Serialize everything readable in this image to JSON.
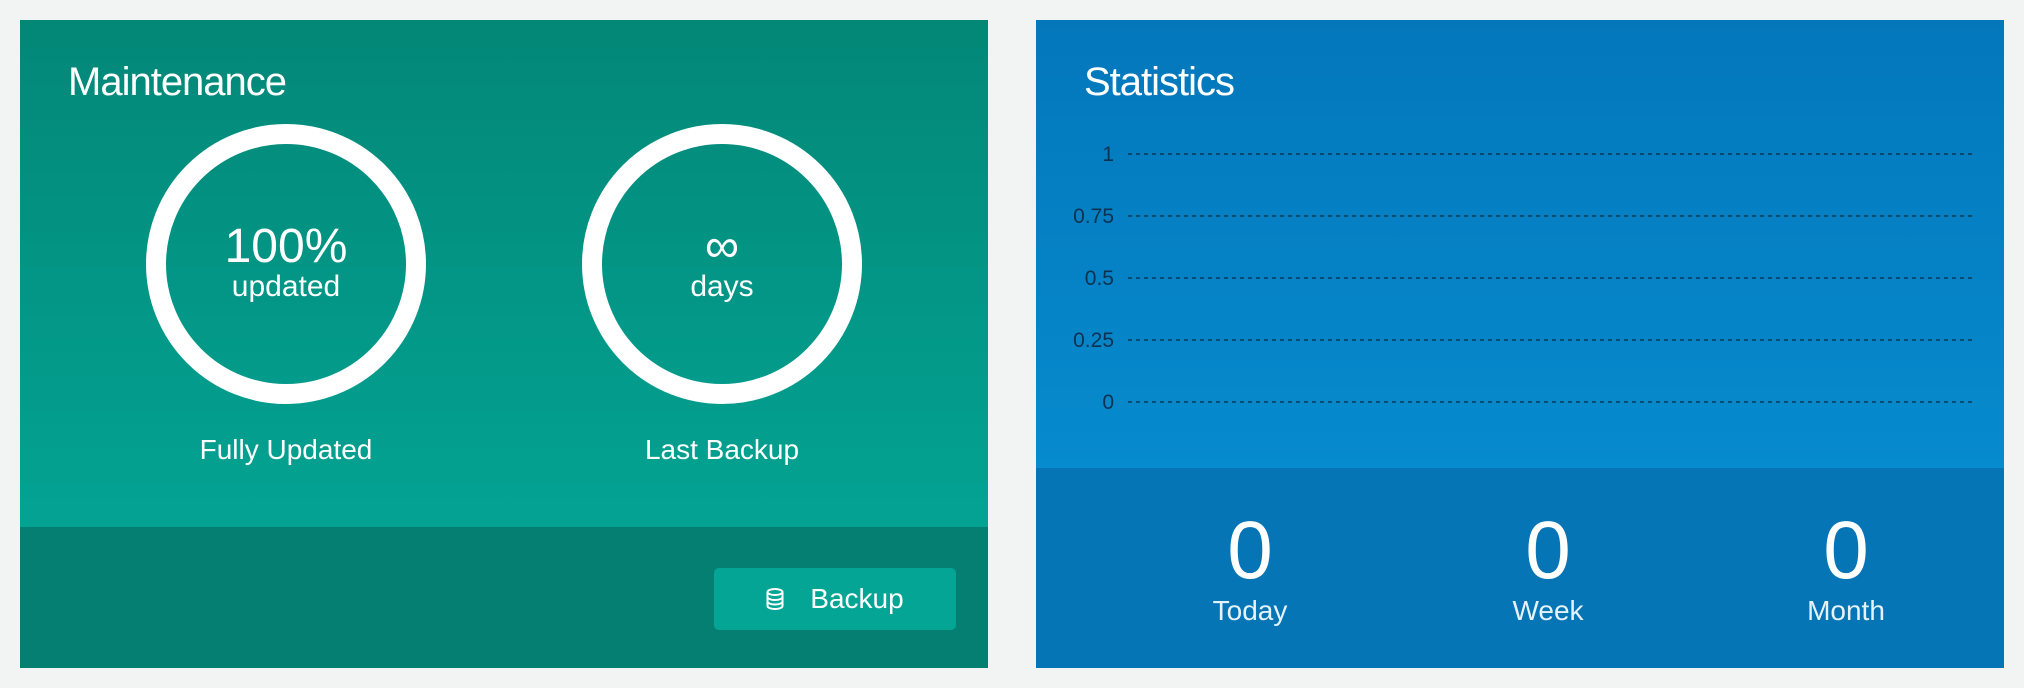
{
  "maintenance": {
    "title": "Maintenance",
    "updated": {
      "value": "100%",
      "unit": "updated",
      "label": "Fully Updated"
    },
    "backup": {
      "value": "∞",
      "unit": "days",
      "label": "Last Backup"
    },
    "backup_button": {
      "icon": "database-icon",
      "label": "Backup"
    }
  },
  "statistics": {
    "title": "Statistics",
    "counters": [
      {
        "value": "0",
        "label": "Today"
      },
      {
        "value": "0",
        "label": "Week"
      },
      {
        "value": "0",
        "label": "Month"
      }
    ]
  },
  "chart_data": {
    "type": "line",
    "yticks": [
      "1",
      "0.75",
      "0.5",
      "0.25",
      "0"
    ],
    "ylim": [
      0,
      1
    ],
    "grid": true,
    "series": []
  },
  "colors": {
    "maintenance_bg": "#038777",
    "maintenance_footer": "#047f71",
    "button_bg": "#04a595",
    "statistics_bg": "#0477bb",
    "statistics_footer": "#0575b5"
  }
}
